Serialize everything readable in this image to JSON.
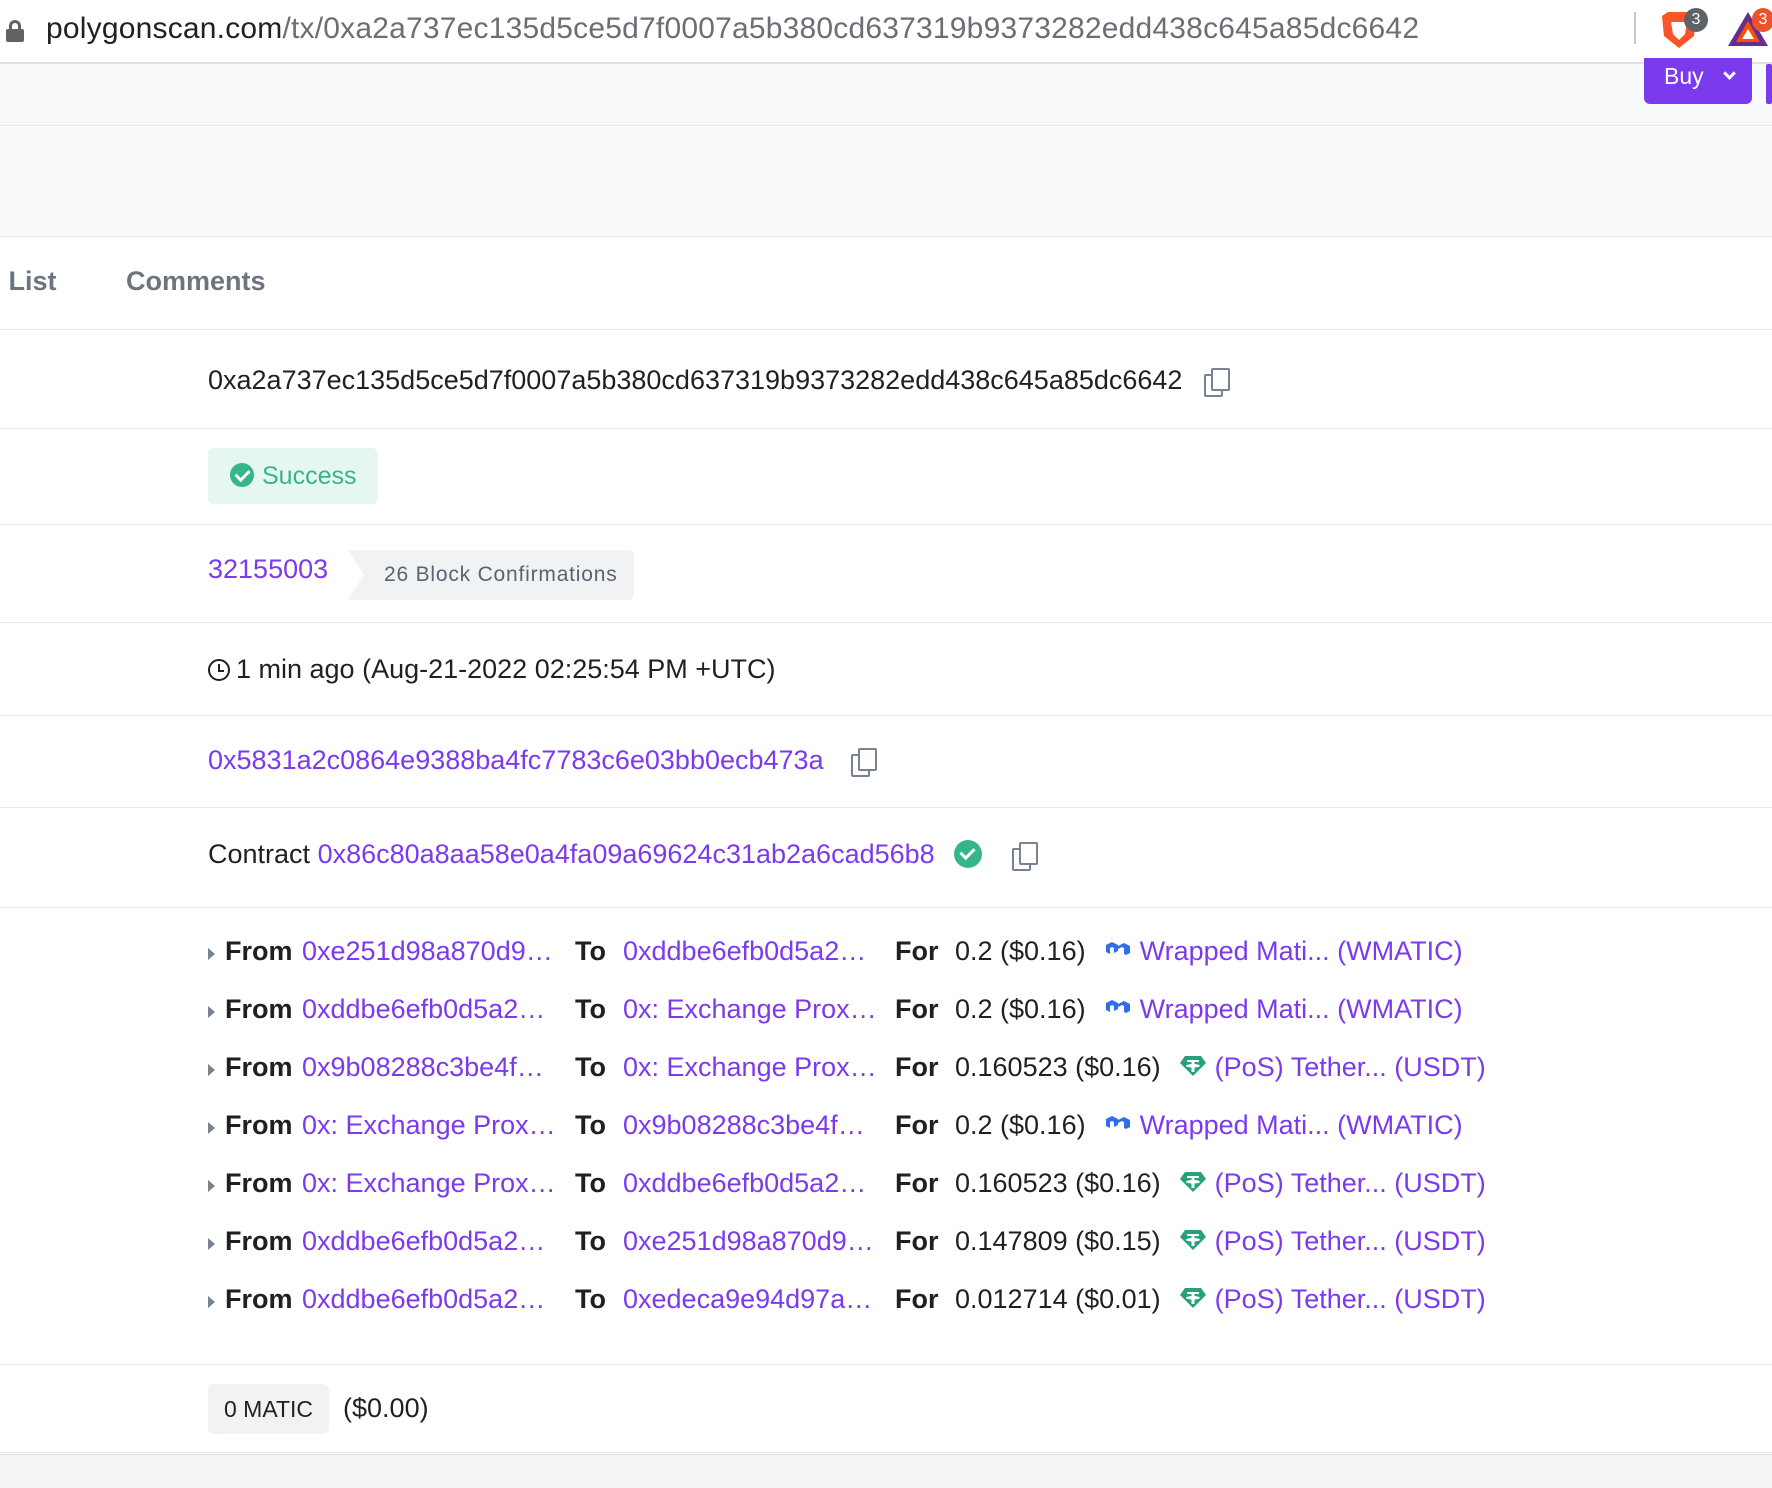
{
  "browser": {
    "url_host": "polygonscan.com",
    "url_path": "/tx/0xa2a737ec135d5ce5d7f0007a5b380cd637319b9373282edd438c645a85dc6642",
    "brave_badge": "3",
    "bat_badge": "3"
  },
  "header": {
    "buy_label": "Buy"
  },
  "tabs": [
    {
      "label": "s List"
    },
    {
      "label": "Comments"
    }
  ],
  "tx": {
    "hash": "0xa2a737ec135d5ce5d7f0007a5b380cd637319b9373282edd438c645a85dc6642",
    "status": "Success",
    "block": "32155003",
    "confirmations": "26 Block Confirmations",
    "timestamp": "1 min ago (Aug-21-2022 02:25:54 PM +UTC)",
    "from": "0x5831a2c0864e9388ba4fc7783c6e03bb0ecb473a",
    "to_prefix": "Contract",
    "to_contract": "0x86c80a8aa58e0a4fa09a69624c31ab2a6cad56b8",
    "value_chip": "0 MATIC",
    "value_usd": "($0.00)"
  },
  "labels": {
    "from": "From",
    "to": "To",
    "for": "For"
  },
  "token_transfers": [
    {
      "from": "0xe251d98a870d9…",
      "to": "0xddbe6efb0d5a2…",
      "amount": "0.2 ($0.16)",
      "token": "Wrapped Mati... (WMATIC)",
      "icon": "polygon-icon"
    },
    {
      "from": "0xddbe6efb0d5a2…",
      "to": "0x: Exchange Prox…",
      "amount": "0.2 ($0.16)",
      "token": "Wrapped Mati... (WMATIC)",
      "icon": "polygon-icon"
    },
    {
      "from": "0x9b08288c3be4f…",
      "to": "0x: Exchange Prox…",
      "amount": "0.160523 ($0.16)",
      "token": "(PoS) Tether... (USDT)",
      "icon": "tether-icon"
    },
    {
      "from": "0x: Exchange Prox…",
      "to": "0x9b08288c3be4f…",
      "amount": "0.2 ($0.16)",
      "token": "Wrapped Mati... (WMATIC)",
      "icon": "polygon-icon"
    },
    {
      "from": "0x: Exchange Prox…",
      "to": "0xddbe6efb0d5a2…",
      "amount": "0.160523 ($0.16)",
      "token": "(PoS) Tether... (USDT)",
      "icon": "tether-icon"
    },
    {
      "from": "0xddbe6efb0d5a2…",
      "to": "0xe251d98a870d9…",
      "amount": "0.147809 ($0.15)",
      "token": "(PoS) Tether... (USDT)",
      "icon": "tether-icon"
    },
    {
      "from": "0xddbe6efb0d5a2…",
      "to": "0xedeca9e94d97a…",
      "amount": "0.012714 ($0.01)",
      "token": "(PoS) Tether... (USDT)",
      "icon": "tether-icon"
    }
  ],
  "colors": {
    "accent": "#7c3aed",
    "success": "#35b58a",
    "tether": "#26a17b",
    "polygon": "#2f6ee8"
  }
}
